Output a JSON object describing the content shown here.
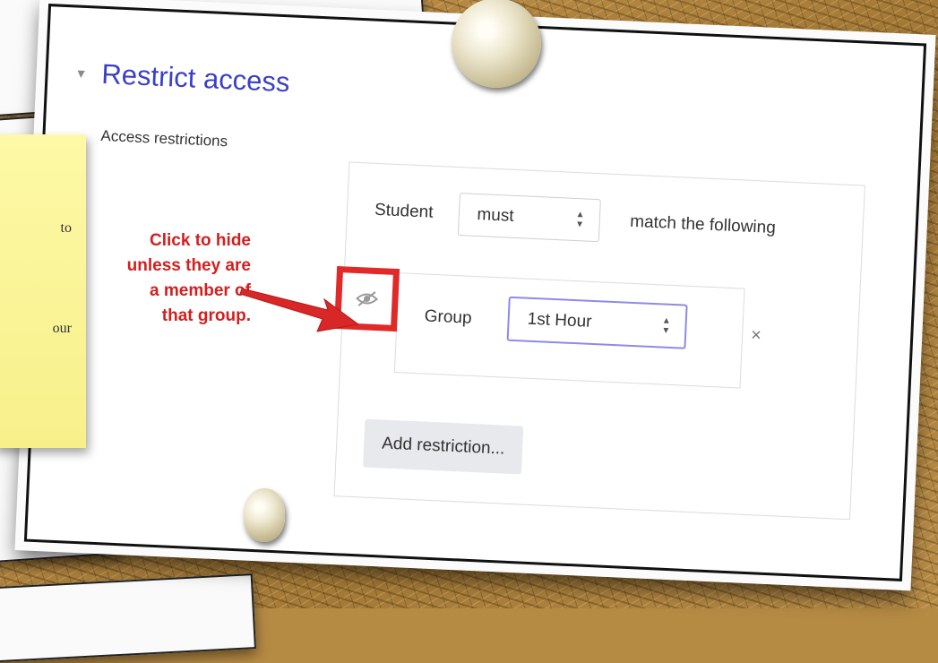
{
  "section": {
    "caret": "▼",
    "title": "Restrict access",
    "restrictions_label": "Access restrictions"
  },
  "rule": {
    "student_label": "Student",
    "must_value": "must",
    "match_text": "match the following"
  },
  "condition": {
    "type_label": "Group",
    "group_value": "1st Hour",
    "remove_symbol": "×",
    "eye_icon": "eye-slash-icon"
  },
  "add_restriction_label": "Add restriction...",
  "annotation": {
    "line1": "Click to hide",
    "line2": "unless they are",
    "line3": "a member of",
    "line4": "that group."
  },
  "sticky_note": {
    "fragment1": "to",
    "fragment2": "our"
  },
  "colors": {
    "accent_title": "#3b3fc7",
    "annotation_red": "#d21f1f",
    "highlight_border": "#e02a2a",
    "focused_select": "#8e8aea"
  }
}
